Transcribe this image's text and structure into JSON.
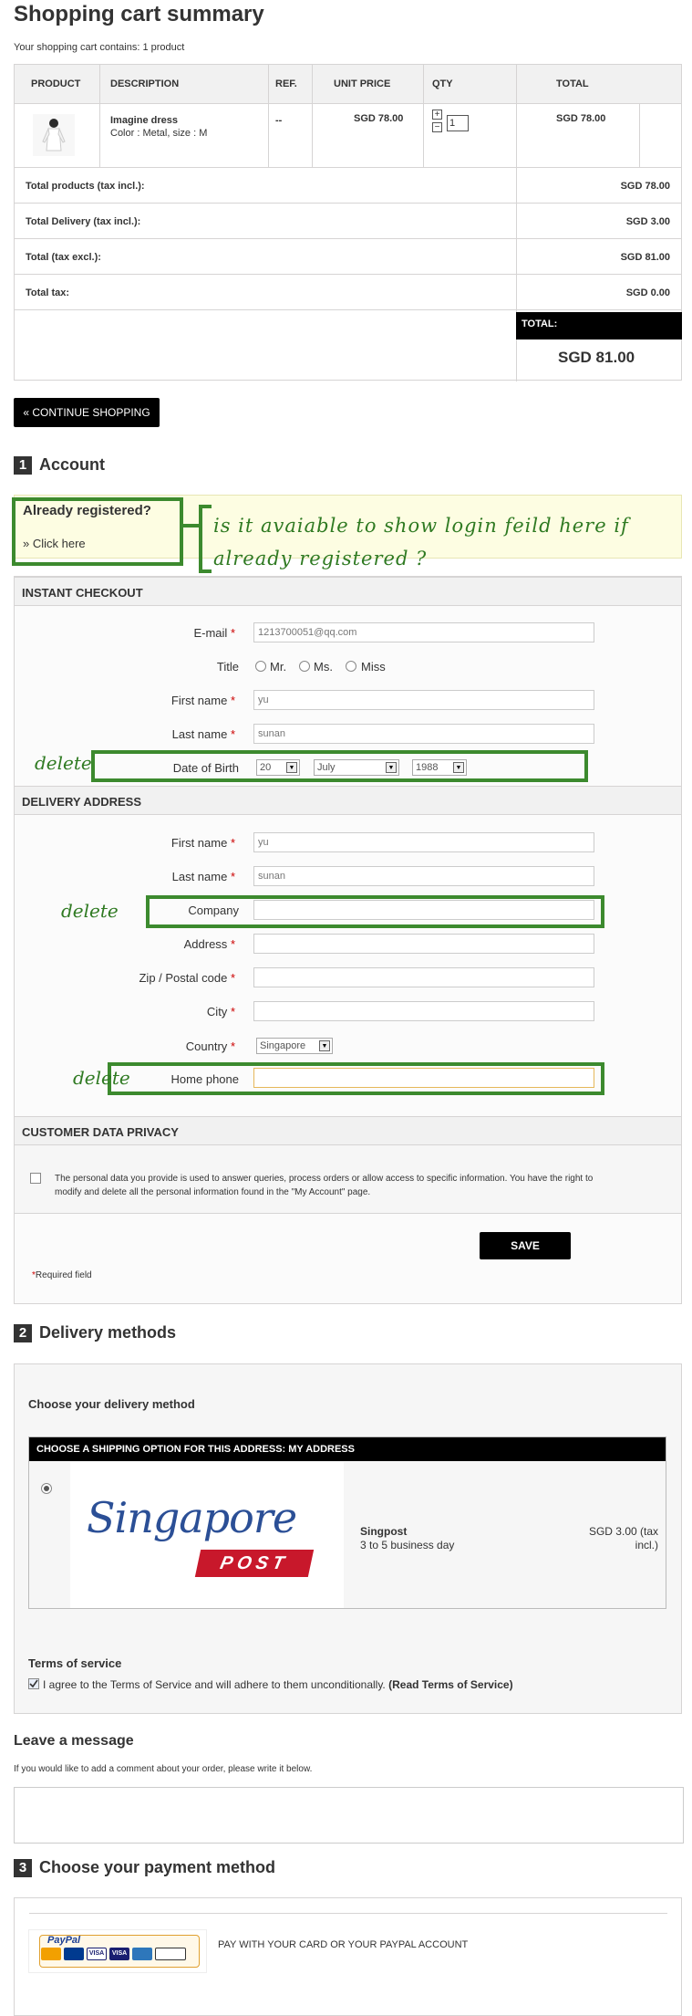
{
  "page_title": "Shopping cart summary",
  "cart_count_text": "Your shopping cart contains: 1 product",
  "cart": {
    "headers": [
      "PRODUCT",
      "DESCRIPTION",
      "REF.",
      "UNIT PRICE",
      "QTY",
      "TOTAL"
    ],
    "item": {
      "name": "Imagine dress",
      "attributes": "Color : Metal, size : M",
      "ref": "--",
      "unit_price": "SGD 78.00",
      "qty": "1",
      "total": "SGD 78.00",
      "plus": "+",
      "minus": "−"
    },
    "summary": [
      {
        "label": "Total products (tax incl.):",
        "value": "SGD 78.00"
      },
      {
        "label": "Total Delivery (tax incl.):",
        "value": "SGD 3.00"
      },
      {
        "label": "Total (tax excl.):",
        "value": "SGD 81.00"
      },
      {
        "label": "Total tax:",
        "value": "SGD 0.00"
      }
    ],
    "total_label": "TOTAL:",
    "total_value": "SGD 81.00"
  },
  "continue_shopping": "« CONTINUE SHOPPING",
  "step1": {
    "num": "1",
    "title": "Account"
  },
  "already": {
    "title": "Already registered?",
    "link": "» Click here"
  },
  "annotation": {
    "note": "is it avaiable to show login feild here if already registered ?",
    "delete1": "delete",
    "delete2": "delete",
    "delete3": "delete"
  },
  "instant": {
    "heading": "INSTANT CHECKOUT",
    "email_label": "E-mail",
    "email_value": "1213700051@qq.com",
    "title_label": "Title",
    "title_options": [
      "Mr.",
      "Ms.",
      "Miss"
    ],
    "firstname_label": "First name",
    "firstname_value": "yu",
    "lastname_label": "Last name",
    "lastname_value": "sunan",
    "dob_label": "Date of Birth",
    "dob_day": "20",
    "dob_month": "July",
    "dob_year": "1988"
  },
  "delivery": {
    "heading": "DELIVERY ADDRESS",
    "firstname_label": "First name",
    "firstname_value": "yu",
    "lastname_label": "Last name",
    "lastname_value": "sunan",
    "company_label": "Company",
    "address_label": "Address",
    "zip_label": "Zip / Postal code",
    "city_label": "City",
    "country_label": "Country",
    "country_value": "Singapore",
    "phone_label": "Home phone"
  },
  "privacy": {
    "heading": "CUSTOMER DATA PRIVACY",
    "text": "The personal data you provide is used to answer queries, process orders or allow access to specific information. You have the right to modify and delete all the personal information found in the \"My Account\" page."
  },
  "save_label": "SAVE",
  "required_text": "Required field",
  "required_star": "*",
  "step2": {
    "num": "2",
    "title": "Delivery methods"
  },
  "delivery_methods": {
    "choose": "Choose your delivery method",
    "shipping_heading": "CHOOSE A SHIPPING OPTION FOR THIS ADDRESS: MY ADDRESS",
    "carrier_logo_text": "Singapore",
    "carrier_logo_post": "POST",
    "carrier_name": "Singpost",
    "carrier_delay": "3 to 5 business day",
    "carrier_price": "SGD 3.00 (tax incl.)",
    "terms_title": "Terms of service",
    "terms_text": "I agree to the Terms of Service and will adhere to them unconditionally.",
    "terms_link": "(Read Terms of Service)"
  },
  "message": {
    "title": "Leave a message",
    "hint": "If you would like to add a comment about your order, please write it below."
  },
  "step3": {
    "num": "3",
    "title": "Choose your payment method"
  },
  "payment": {
    "paypal_text": "PAY WITH YOUR CARD OR YOUR PAYPAL ACCOUNT",
    "paypal_logo": "PayPal",
    "cards": [
      "VISA",
      "VISA"
    ]
  },
  "colors": {
    "accent_green": "#3c8a2e",
    "black": "#000000",
    "required_red": "#cc0000",
    "note_bg": "#fdfde2"
  }
}
